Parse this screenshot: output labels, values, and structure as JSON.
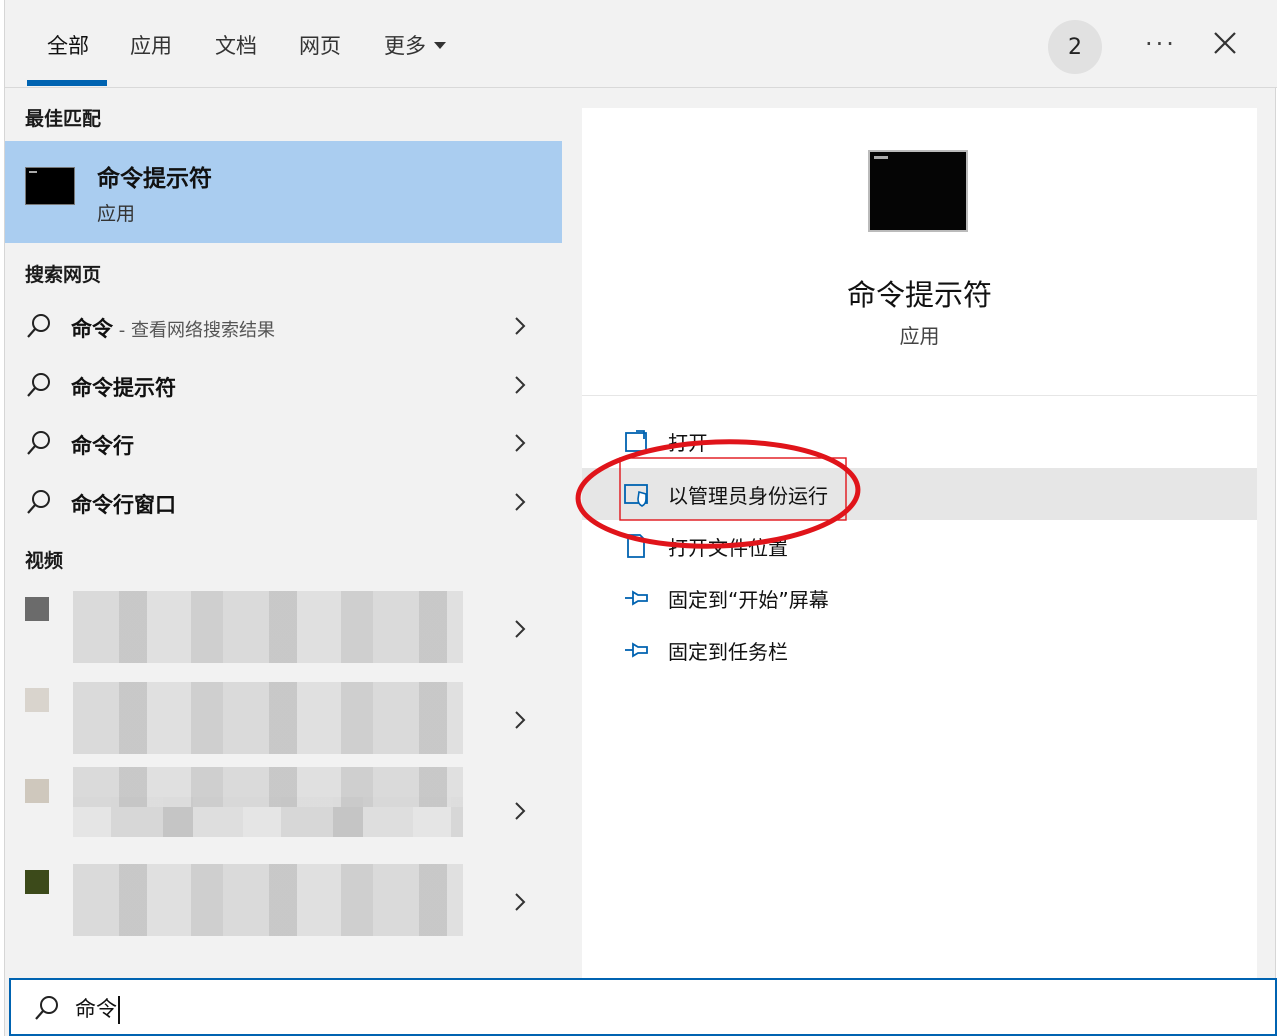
{
  "tabs": [
    {
      "label": "全部",
      "active": true
    },
    {
      "label": "应用"
    },
    {
      "label": "文档"
    },
    {
      "label": "网页"
    },
    {
      "label": "更多"
    }
  ],
  "header": {
    "badge_count": "2",
    "more_icon": "ellipsis-icon",
    "close_icon": "close-icon"
  },
  "best_match": {
    "section": "最佳匹配",
    "title": "命令提示符",
    "subtitle": "应用"
  },
  "web_search": {
    "section": "搜索网页",
    "items": [
      {
        "label": "命令",
        "hint": " - 查看网络搜索结果"
      },
      {
        "label": "命令提示符"
      },
      {
        "label": "命令行"
      },
      {
        "label": "命令行窗口"
      }
    ]
  },
  "videos": {
    "section": "视频",
    "items": [
      {},
      {},
      {},
      {}
    ]
  },
  "details": {
    "title": "命令提示符",
    "subtitle": "应用",
    "actions": [
      {
        "label": "打开",
        "icon": "open-icon"
      },
      {
        "label": "以管理员身份运行",
        "icon": "shield-icon"
      },
      {
        "label": "打开文件位置",
        "icon": "file-location-icon"
      },
      {
        "label": "固定到“开始”屏幕",
        "icon": "pin-icon"
      },
      {
        "label": "固定到任务栏",
        "icon": "pin-icon"
      }
    ]
  },
  "search": {
    "value": "命令"
  },
  "colors": {
    "accent": "#0063b1",
    "selected": "#aacdf0",
    "annotation": "#e0141a"
  }
}
